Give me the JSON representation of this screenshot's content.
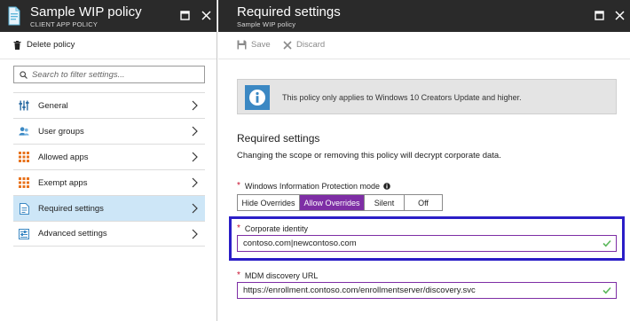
{
  "left_blade": {
    "title": "Sample WIP policy",
    "subtitle": "CLIENT APP POLICY",
    "toolbar": {
      "delete_label": "Delete policy"
    },
    "filter": {
      "placeholder": "Search to filter settings...",
      "value": ""
    },
    "nav_items": [
      {
        "label": "General",
        "icon": "sliders-icon",
        "active": false
      },
      {
        "label": "User groups",
        "icon": "users-icon",
        "active": false
      },
      {
        "label": "Allowed apps",
        "icon": "apps-grid-icon",
        "active": false
      },
      {
        "label": "Exempt apps",
        "icon": "apps-grid-icon",
        "active": false
      },
      {
        "label": "Required settings",
        "icon": "document-icon",
        "active": true
      },
      {
        "label": "Advanced settings",
        "icon": "settings-sliders-icon",
        "active": false
      }
    ]
  },
  "right_blade": {
    "title": "Required settings",
    "subtitle": "Sample WIP policy",
    "toolbar": {
      "save_label": "Save",
      "discard_label": "Discard"
    },
    "info_message": "This policy only applies to Windows 10 Creators Update and higher.",
    "section_title": "Required settings",
    "section_desc": "Changing the scope or removing this policy will decrypt corporate data.",
    "wip_mode": {
      "label": "Windows Information Protection mode",
      "options": [
        "Hide Overrides",
        "Allow Overrides",
        "Silent",
        "Off"
      ],
      "selected": "Allow Overrides"
    },
    "corporate_identity": {
      "label": "Corporate identity",
      "value": "contoso.com|newcontoso.com"
    },
    "mdm_url": {
      "label": "MDM discovery URL",
      "value": "https://enrollment.contoso.com/enrollmentserver/discovery.svc"
    }
  },
  "colors": {
    "header_bg": "#2a2a2a",
    "accent_purple": "#7e2ea5",
    "active_nav_bg": "#cde6f7",
    "info_blue": "#3b88c3",
    "highlight_box": "#2b1ec7",
    "valid_check": "#5cb85c",
    "required_star": "#c8102e"
  }
}
